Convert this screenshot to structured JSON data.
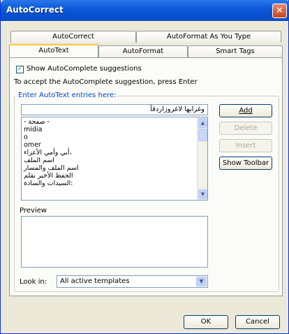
{
  "window": {
    "title": "AutoCorrect",
    "close_glyph": "✕"
  },
  "tabs": {
    "row1": [
      {
        "label": "AutoCorrect"
      },
      {
        "label": "AutoFormat As You Type"
      }
    ],
    "row2": [
      {
        "label": "AutoText",
        "active": true
      },
      {
        "label": "AutoFormat"
      },
      {
        "label": "Smart Tags"
      }
    ]
  },
  "autocomplete": {
    "checkbox_label": "Show AutoComplete suggestions",
    "checked": true,
    "hint": "To accept the AutoComplete suggestion, press Enter"
  },
  "entries": {
    "group_label": "Enter AutoText entries here:",
    "input_value": "وغرايها لاغروزاردقآ",
    "list_items": [
      {
        "text": "- صفحة -",
        "rtl": false
      },
      {
        "text": "midia",
        "rtl": false
      },
      {
        "text": "o",
        "rtl": false
      },
      {
        "text": "omer",
        "rtl": false
      },
      {
        "text": "أبي وأمي الأعزاء،",
        "rtl": false
      },
      {
        "text": "اسم الملف",
        "rtl": false
      },
      {
        "text": "اسم الملف والمسار",
        "rtl": false
      },
      {
        "text": "الحفظ الأخير بقلم",
        "rtl": false
      },
      {
        "text": "السيدات والسادة:",
        "rtl": false
      }
    ]
  },
  "buttons": {
    "add": "Add",
    "delete": "Delete",
    "insert": "Insert",
    "show_toolbar": "Show Toolbar"
  },
  "preview": {
    "label": "Preview"
  },
  "look_in": {
    "label": "Look in:",
    "selected": "All active templates"
  },
  "footer": {
    "ok": "OK",
    "cancel": "Cancel"
  },
  "colors": {
    "title_bar": "#0a57d8",
    "group_label": "#0046d5",
    "active_tab_highlight": "#ffc83c"
  }
}
